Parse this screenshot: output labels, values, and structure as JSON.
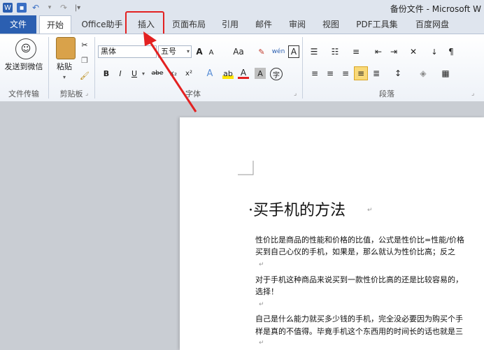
{
  "window": {
    "title": "备份文件 - Microsoft W"
  },
  "tabs": [
    "文件",
    "开始",
    "Office助手",
    "插入",
    "页面布局",
    "引用",
    "邮件",
    "审阅",
    "视图",
    "PDF工具集",
    "百度网盘"
  ],
  "ribbon": {
    "wechat_group": {
      "button": "发送到微信",
      "label": "文件传输"
    },
    "clipboard": {
      "paste": "粘贴",
      "label": "剪贴板"
    },
    "font": {
      "face": "黑体",
      "size": "五号",
      "label": "字体",
      "bold": "B",
      "italic": "I",
      "underline": "U",
      "strike": "abe",
      "sub": "x₂",
      "sup": "x²",
      "grow": "A",
      "shrink": "A",
      "change_case": "Aa",
      "phonetic": "wén",
      "char_border": "A",
      "font_color": "A",
      "char_shading": "A",
      "enclose": "字"
    },
    "paragraph": {
      "label": "段落"
    }
  },
  "document": {
    "heading": "·买手机的方法",
    "paragraphs": [
      "性价比是商品的性能和价格的比值，公式是性价比=性能/价格",
      "买到自己心仪的手机，如果是，那么就认为性价比高；反之",
      "",
      "对于手机这种商品来说买到一款性价比高的还是比较容易的，",
      "选择！",
      "",
      "自己是什么能力就买多少钱的手机，完全没必要因为购买个手",
      "样是真的不值得。毕竟手机这个东西用的时间长的话也就是三"
    ]
  },
  "colors": {
    "file_tab": "#2b5fb1",
    "highlight": "#e32121"
  }
}
